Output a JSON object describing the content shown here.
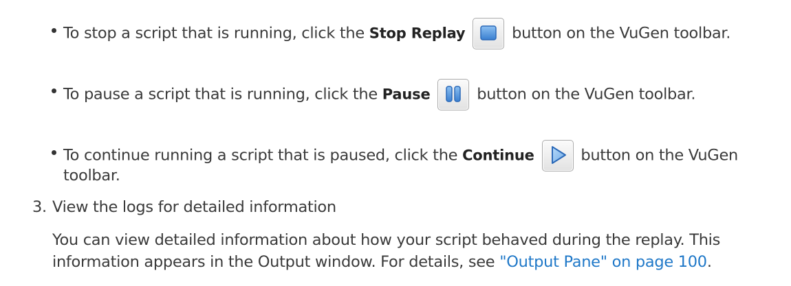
{
  "bullets": [
    {
      "pre": "To stop a script that is running, click the",
      "bold": "Stop Replay",
      "icon": "stop-icon",
      "post": "button on the VuGen toolbar."
    },
    {
      "pre": "To pause a script that is running, click the",
      "bold": "Pause",
      "icon": "pause-icon",
      "post": "button on the VuGen toolbar."
    },
    {
      "pre": "To continue running a script that is paused, click the",
      "bold": "Continue",
      "icon": "continue-icon",
      "post": "button on the VuGen",
      "post2": "toolbar."
    }
  ],
  "step": {
    "number": "3.",
    "title": "View the logs for detailed information",
    "body_line1": "You can view detailed information about how your script behaved during the replay. This",
    "body_line2_pre": "information appears in the Output window. For details, see",
    "link_text": "\"Output Pane\" on page 100",
    "body_line2_post": "."
  },
  "colors": {
    "text": "#3a3a3a",
    "link": "#1f78c8",
    "icon_blue": "#4a8fd8"
  }
}
